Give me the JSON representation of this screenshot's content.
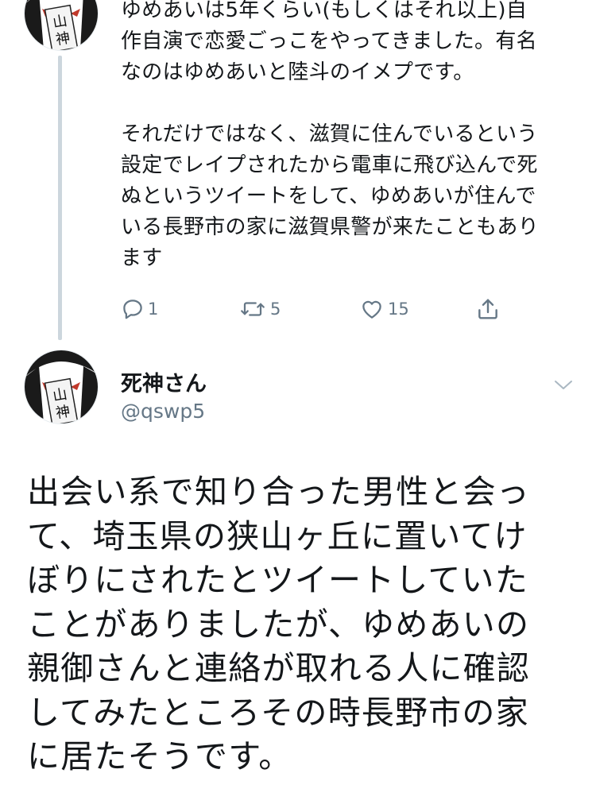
{
  "previous_tweet": {
    "avatar_icon": "shinigami-avatar-icon",
    "text": "ゆめあいは5年くらい(もしくはそれ以上)自\n作自演で恋愛ごっこをやってきました。有名\nなのはゆめあいと陸斗のイメプです。\n\nそれだけではなく、滋賀に住んでいるという\n設定でレイプされたから電車に飛び込んで死\nぬというツイートをして、ゆめあいが住んで\nいる長野市の家に滋賀県警が来たこともあり\nます",
    "actions": {
      "reply_icon": "reply-icon",
      "reply_count": "1",
      "retweet_icon": "retweet-icon",
      "retweet_count": "5",
      "like_icon": "heart-icon",
      "like_count": "15",
      "share_icon": "share-icon"
    }
  },
  "main_tweet": {
    "avatar_icon": "shinigami-avatar-icon",
    "display_name": "死神さん",
    "handle": "@qswp5",
    "caret_icon": "chevron-down-icon",
    "text": "出会い系で知り合った男性と会っ\nて、埼玉県の狭山ヶ丘に置いてけ\nぼりにされたとツイートしていた\nことがありましたが、ゆめあいの\n親御さんと連絡が取れる人に確認\nしてみたところその時長野市の家\nに居たそうです。"
  },
  "colors": {
    "text_primary": "#14171a",
    "text_secondary": "#657786",
    "thread_line": "#ccd6dd",
    "background": "#ffffff"
  }
}
